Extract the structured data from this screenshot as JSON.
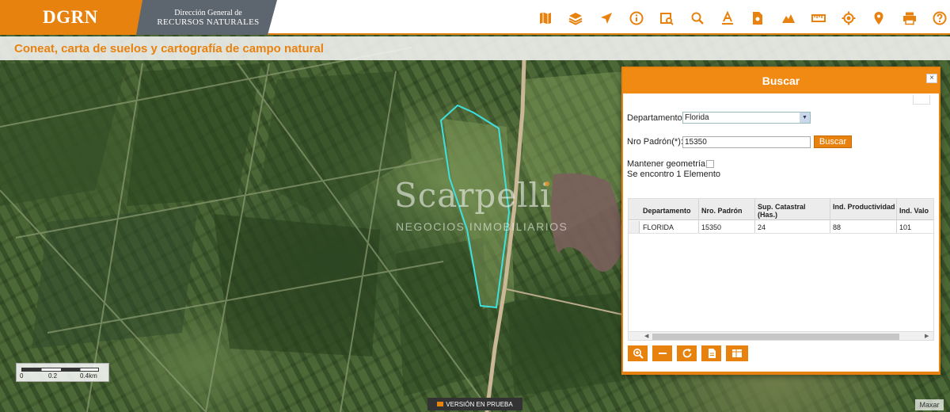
{
  "header": {
    "logo": "DGRN",
    "org_line1": "Dirección General de",
    "org_line2": "RECURSOS NATURALES"
  },
  "toolbar": {
    "icons": [
      "map-icon",
      "layers-icon",
      "navigate-icon",
      "info-icon",
      "image-search-icon",
      "search-icon",
      "text-icon",
      "document-icon",
      "terrain-icon",
      "ruler-icon",
      "locate-icon",
      "pin-icon",
      "print-icon",
      "help-icon"
    ],
    "icon_color": "#e8820f"
  },
  "subtitle": "Coneat, carta de suelos y cartografía de campo natural",
  "watermark": {
    "name": "Scarpelli",
    "tagline": "NEGOCIOS INMOBILIARIOS"
  },
  "scale": {
    "labels": [
      "0",
      "0.2",
      "0.4km"
    ]
  },
  "version_badge": "VERSIÓN EN PRUEBA",
  "attribution": "Maxar",
  "panel": {
    "title": "Buscar",
    "close": "×",
    "departamento_label": "Departamento",
    "departamento_value": "Florida",
    "padron_label": "Nro Padrón(*):",
    "padron_value": "15350",
    "search_button": "Buscar",
    "mantener_label": "Mantener geometría",
    "result_text": "Se encontro 1 Elemento",
    "columns": [
      "Departamento",
      "Nro. Padrón",
      "Sup. Catastral (Has.)",
      "Ind. Productividad",
      "Ind. Valo"
    ],
    "rows": [
      [
        "FLORIDA",
        "15350",
        "24",
        "88",
        "101"
      ]
    ]
  },
  "colors": {
    "accent": "#e8820f",
    "header_gray": "#5d666f",
    "parcel_outline": "#3fe0e0"
  }
}
